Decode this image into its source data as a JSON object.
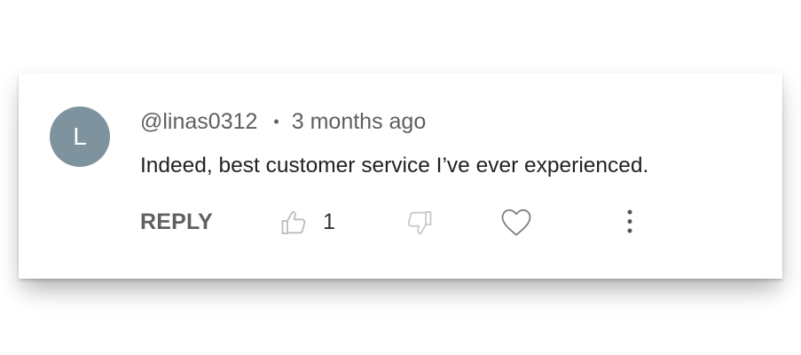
{
  "comment": {
    "avatar_initial": "L",
    "avatar_color": "#7e939e",
    "author": "@linas0312",
    "separator": "•",
    "timestamp": "3 months ago",
    "text": "Indeed, best customer service I’ve ever experienced.",
    "actions": {
      "reply_label": "REPLY",
      "like_count": "1",
      "like_icon": "thumbs-up-icon",
      "dislike_icon": "thumbs-down-icon",
      "heart_icon": "heart-icon",
      "more_icon": "more-vertical-icon"
    }
  }
}
